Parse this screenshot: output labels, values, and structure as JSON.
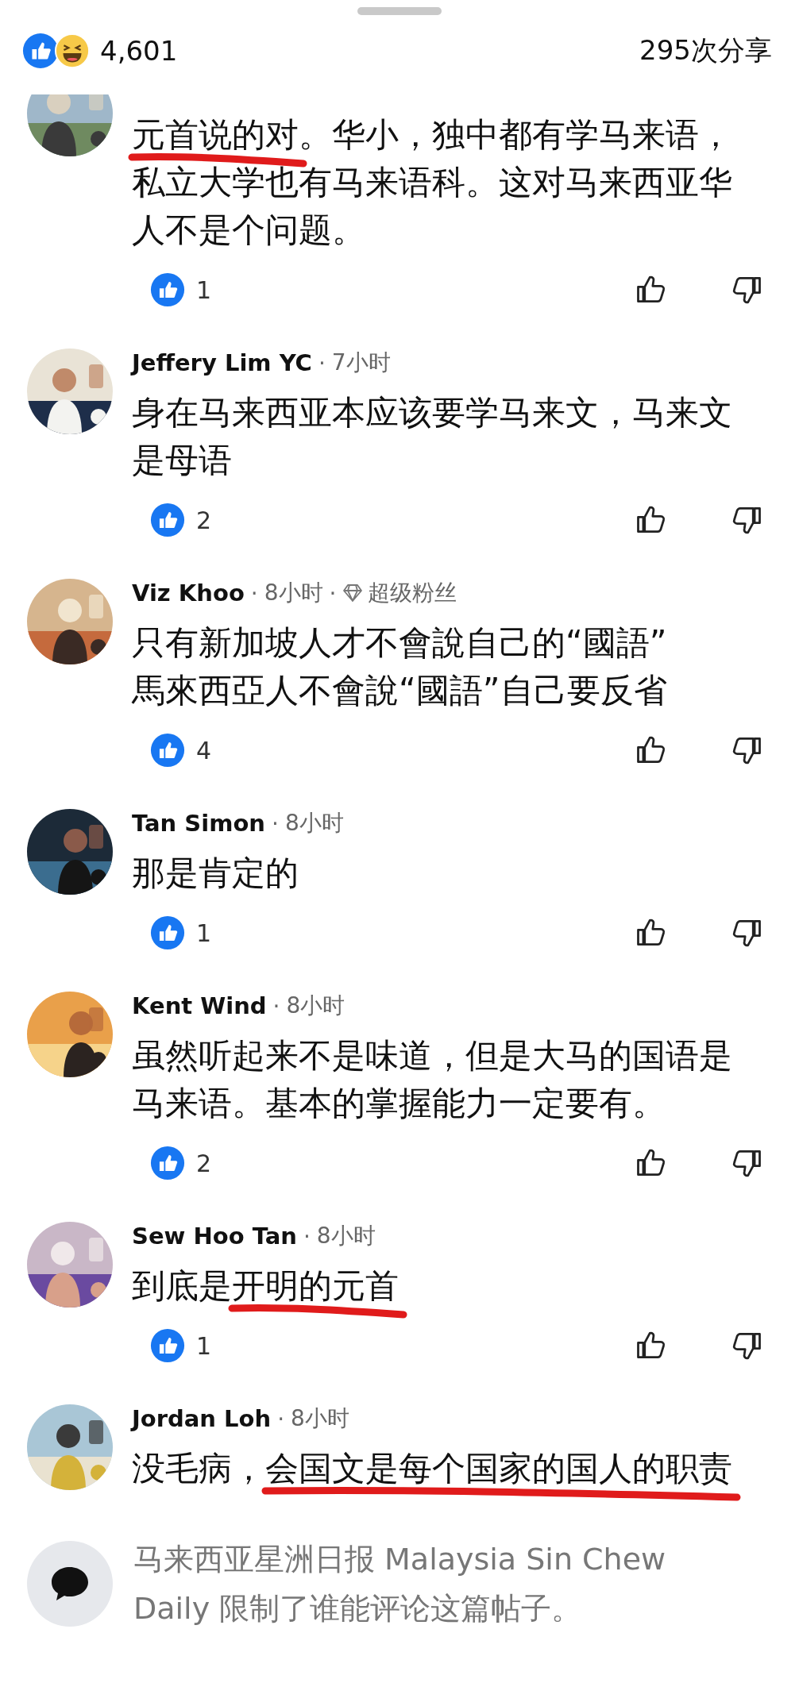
{
  "header": {
    "reaction_count": "4,601",
    "shares": "295次分享"
  },
  "comments": [
    {
      "parts": [
        {
          "text": "元首说的对",
          "struck": true
        },
        {
          "text": "。华小，独中都有学马来语，私立大学也有马来语科。这对马来西亚华人不是个问题。",
          "struck": false
        }
      ],
      "likes": "1"
    },
    {
      "name": "Jeffery Lim YC",
      "time_separator": "·",
      "time": "7小时",
      "parts": [
        {
          "text": "身在马来西亚本应该要学马来文，马来文是母语",
          "struck": false
        }
      ],
      "likes": "2"
    },
    {
      "name": "Viz Khoo",
      "time_separator": "·",
      "time": "8小时",
      "badge_separator": "·",
      "badge": "超级粉丝",
      "parts": [
        {
          "text": "只有新加坡人才不會說自己的“國語”\n馬來西亞人不會說“國語”自己要反省",
          "struck": false
        }
      ],
      "likes": "4"
    },
    {
      "name": "Tan Simon",
      "time_separator": "·",
      "time": "8小时",
      "parts": [
        {
          "text": "那是肯定的",
          "struck": false
        }
      ],
      "likes": "1"
    },
    {
      "name": "Kent Wind",
      "time_separator": "·",
      "time": "8小时",
      "parts": [
        {
          "text": "虽然听起来不是味道，但是大马的国语是马来语。基本的掌握能力一定要有。",
          "struck": false
        }
      ],
      "likes": "2"
    },
    {
      "name": "Sew Hoo Tan",
      "time_separator": "·",
      "time": "8小时",
      "parts": [
        {
          "text": "到底是",
          "struck": false
        },
        {
          "text": "开明的元首",
          "struck": true
        }
      ],
      "likes": "1"
    },
    {
      "name": "Jordan Loh",
      "time_separator": "·",
      "time": "8小时",
      "parts": [
        {
          "text": "没毛病，",
          "struck": false
        },
        {
          "text": "会国文是每个国家的国人的职责",
          "struck": true
        }
      ]
    }
  ],
  "footer": {
    "notice": "马来西亚星洲日报 Malaysia Sin Chew Daily 限制了谁能评论这篇帖子。"
  }
}
